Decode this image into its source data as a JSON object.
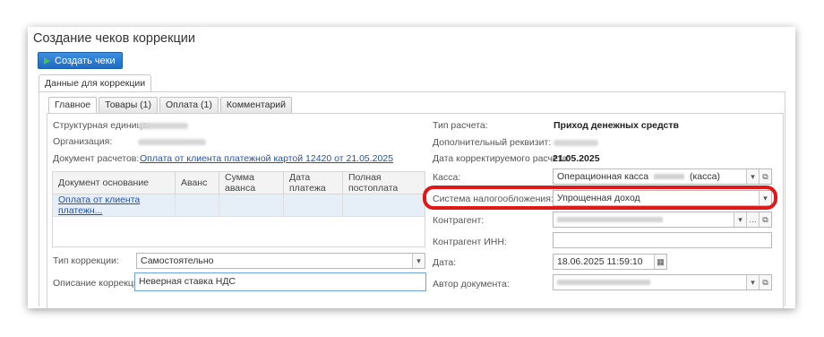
{
  "window": {
    "title": "Создание чеков коррекции"
  },
  "toolbar": {
    "create_label": "Создать чеки"
  },
  "outer_tab": {
    "label": "Данные для коррекции"
  },
  "tabs": [
    {
      "label": "Главное"
    },
    {
      "label": "Товары (1)"
    },
    {
      "label": "Оплата (1)"
    },
    {
      "label": "Комментарий"
    }
  ],
  "left": {
    "struct_unit_label": "Структурная единица:",
    "org_label": "Организация:",
    "doc_label": "Документ расчетов:",
    "doc_link": "Оплата от клиента платежной картой 12420 от 21.05.2025",
    "table": {
      "headers": [
        "Документ основание",
        "Аванс",
        "Сумма аванса",
        "Дата платежа",
        "Полная постоплата"
      ],
      "row_doc": "Оплата от клиента платежн..."
    },
    "correction_type_label": "Тип коррекции:",
    "correction_type_value": "Самостоятельно",
    "correction_desc_label": "Описание коррекции:",
    "correction_desc_value": "Неверная ставка НДС"
  },
  "right": {
    "calc_type_label": "Тип расчета:",
    "calc_type_value": "Приход денежных средств",
    "extra_req_label": "Дополнительный реквизит:",
    "date_corr_label": "Дата корректируемого расчета:",
    "date_corr_value": "21.05.2025",
    "kassa_label": "Касса:",
    "kassa_value_a": "Операционная касса",
    "kassa_value_b": "(касса)",
    "tax_label": "Система налогообложения:",
    "tax_value": "Упрощенная доход",
    "contractor_label": "Контрагент:",
    "contractor_inn_label": "Контрагент ИНН:",
    "date_label": "Дата:",
    "date_value": "18.06.2025 11:59:10",
    "author_label": "Автор документа:"
  },
  "colors": {
    "highlight": "#e01818",
    "link": "#2452a8",
    "button": "#1f6cc4"
  }
}
